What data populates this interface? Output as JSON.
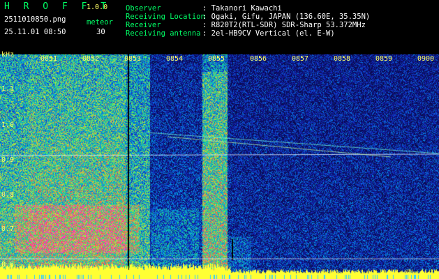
{
  "header": {
    "app_name": "H R O F F T",
    "version": "1.0.0",
    "filename": "2511010850.png",
    "datetime": "25.11.01 08:50",
    "meteor_label": "meteor",
    "meteor_count": "30",
    "fields": [
      {
        "label": "Observer",
        "value": ": Takanori Kawachi"
      },
      {
        "label": "Receiving Location",
        "value": ": Ogaki, Gifu, JAPAN (136.60E, 35.35N)"
      },
      {
        "label": "Receiver",
        "value": ": R820T2(RTL-SDR) SDR-Sharp 53.372MHz"
      },
      {
        "label": "Receiving antenna",
        "value": ": 2el-HB9CV Vertical (el. E-W)"
      }
    ]
  },
  "axes": {
    "y_unit": "kHz",
    "y_ticks": [
      "1.1",
      "1.0",
      "0.9",
      "0.8",
      "0.7",
      "0.6"
    ],
    "x_ticks": [
      "0851",
      "0852",
      "0853",
      "0854",
      "0855",
      "0856",
      "0857",
      "0858",
      "0859",
      "0900"
    ]
  },
  "colors": {
    "text_green": "#00ff66",
    "text_yellow": "#ffff66",
    "text_white": "#ffffff",
    "background": "#000000"
  }
}
